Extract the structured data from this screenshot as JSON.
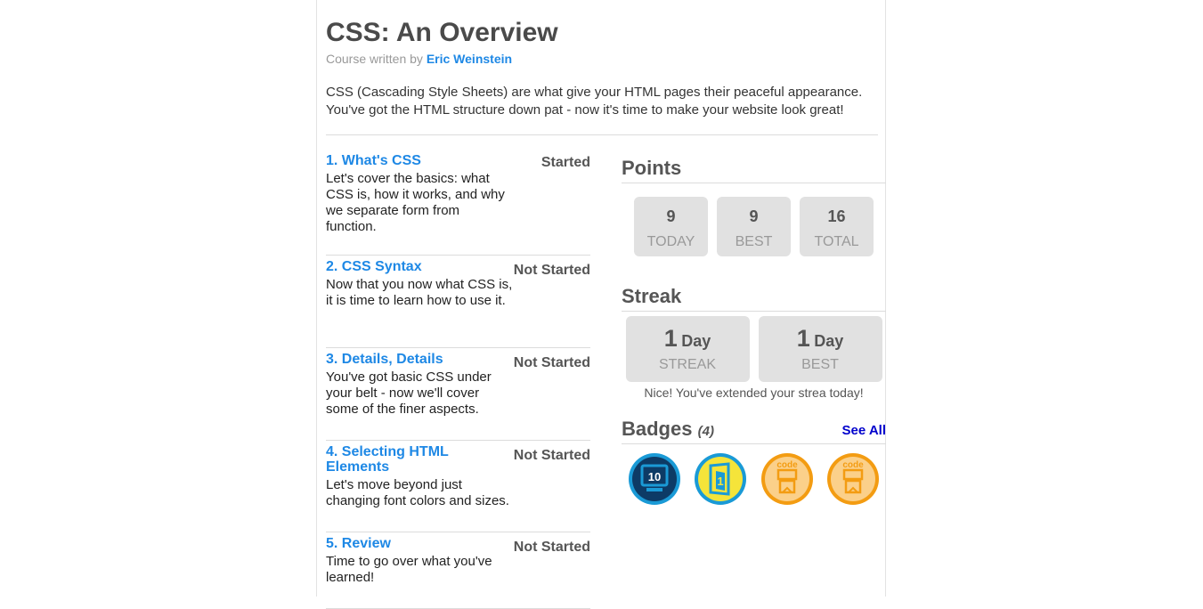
{
  "course": {
    "title": "CSS: An Overview",
    "byline_prefix": "Course written by",
    "author": "Eric Weinstein",
    "description": "CSS (Cascading Style Sheets) are what give your HTML pages their peaceful appearance. You've got the HTML structure down pat - now it's time to make your website look great!"
  },
  "lessons": [
    {
      "title": "1. What's CSS",
      "status": "Started",
      "description": "Let's cover the basics: what CSS is, how it works, and why we separate form from function."
    },
    {
      "title": "2. CSS Syntax",
      "status": "Not Started",
      "description": "Now that you now what CSS is, it is time to learn how to use it."
    },
    {
      "title": "3. Details, Details",
      "status": "Not Started",
      "description": "You've got basic CSS under your belt - now we'll cover some of the finer aspects."
    },
    {
      "title": "4. Selecting HTML Elements",
      "status": "Not Started",
      "description": "Let's move beyond just changing font colors and sizes."
    },
    {
      "title": "5. Review",
      "status": "Not Started",
      "description": "Time to go over what you've learned!"
    }
  ],
  "points": {
    "heading": "Points",
    "items": [
      {
        "value": "9",
        "label": "TODAY"
      },
      {
        "value": "9",
        "label": "BEST"
      },
      {
        "value": "16",
        "label": "TOTAL"
      }
    ]
  },
  "streak": {
    "heading": "Streak",
    "items": [
      {
        "value": "1",
        "unit": "Day",
        "label": "STREAK"
      },
      {
        "value": "1",
        "unit": "Day",
        "label": "BEST"
      }
    ],
    "note": "Nice! You've extended your strea today!"
  },
  "badges": {
    "heading": "Badges",
    "count": "(4)",
    "see_all": "See All",
    "items": [
      {
        "icon": "ten-exercises-badge-icon",
        "text": "10"
      },
      {
        "icon": "first-exercise-badge-icon",
        "text": "1"
      },
      {
        "icon": "code-badge-icon",
        "text": "code"
      },
      {
        "icon": "code-badge-icon",
        "text": "code"
      }
    ],
    "colors": {
      "blue": "#1a9ad6",
      "navy": "#0d3b66",
      "yellow": "#f5c518",
      "orange": "#f39c12"
    }
  },
  "colors": {
    "link": "#1e88e5",
    "see_all": "#0000cc",
    "box_bg": "#e1e1e1"
  }
}
